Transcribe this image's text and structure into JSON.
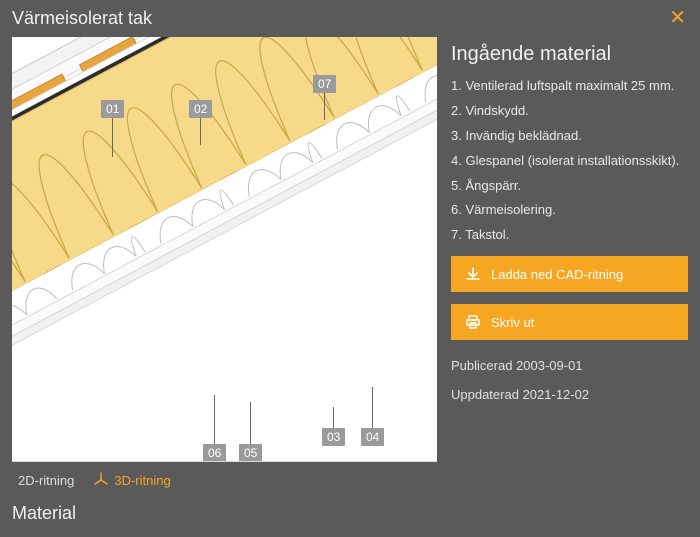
{
  "title": "Värmeisolerat tak",
  "materials_header": "Ingående material",
  "materials_list": [
    "Ventilerad luftspalt maximalt 25 mm.",
    "Vindskydd.",
    "Invändig beklädnad.",
    "Glespanel (isolerat installationsskikt).",
    "Ångspärr.",
    "Värmeisolering.",
    "Takstol."
  ],
  "callouts": {
    "c01": "01",
    "c02": "02",
    "c03": "03",
    "c04": "04",
    "c05": "05",
    "c06": "06",
    "c07": "07"
  },
  "tabs": {
    "tab2d": "2D-ritning",
    "tab3d": "3D-ritning"
  },
  "buttons": {
    "download": "Ladda ned CAD-ritning",
    "print": "Skriv ut"
  },
  "meta": {
    "published_label": "Publicerad",
    "published_value": "2003-09-01",
    "updated_label": "Uppdaterad",
    "updated_value": "2021-12-02"
  },
  "section_material": "Material",
  "colors": {
    "accent": "#f5a623",
    "insulation": "#f6d989",
    "battens": "#e8a53f"
  }
}
